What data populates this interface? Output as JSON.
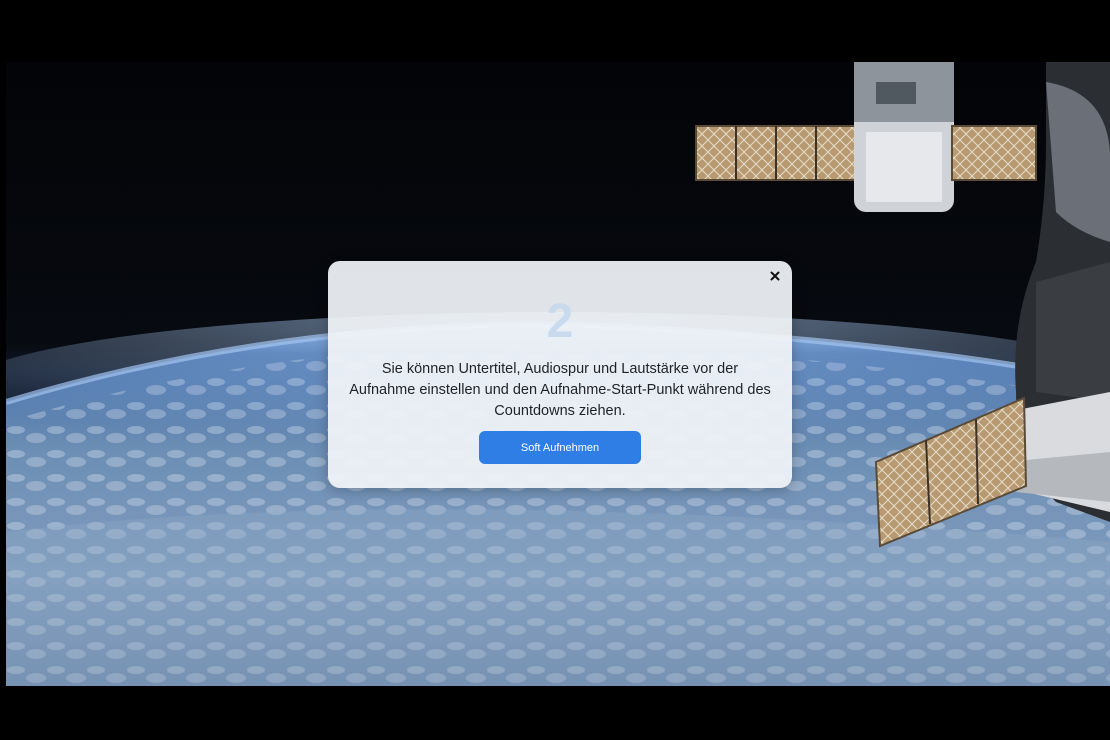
{
  "dialog": {
    "countdown": "2",
    "message": "Sie können Untertitel, Audiospur und Lautstärke vor der Aufnahme einstellen und den Aufnahme-Start-Punkt während des Countdowns ziehen.",
    "close_label": "×",
    "record_button_label": "Soft Aufnehmen"
  },
  "colors": {
    "button": "#2f7ee6",
    "countdown": "#c9daee",
    "dialog_background": "#f1f4f8"
  },
  "icons": {
    "close": "close-icon"
  }
}
